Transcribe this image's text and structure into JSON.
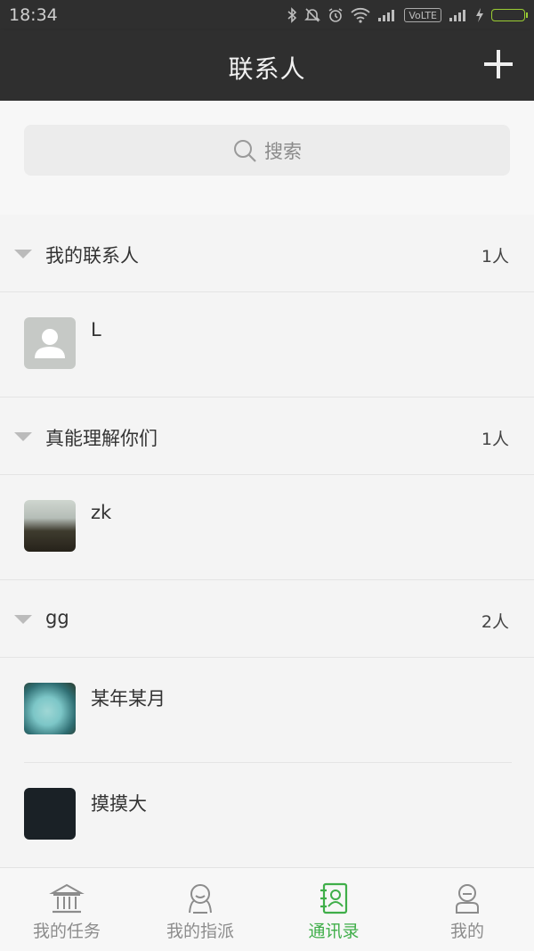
{
  "status_bar": {
    "time": "18:34",
    "network_label": "VoLTE",
    "icons": [
      "bluetooth-icon",
      "mute-icon",
      "alarm-icon",
      "wifi-icon",
      "signal-icon",
      "signal-icon",
      "charging-icon",
      "battery-icon"
    ]
  },
  "header": {
    "title": "联系人",
    "add_icon": "plus-icon"
  },
  "search": {
    "placeholder": "搜索",
    "icon": "search-icon"
  },
  "groups": [
    {
      "name": "我的联系人",
      "count": "1人",
      "contacts": [
        {
          "name": "L",
          "avatar": "default-avatar"
        }
      ]
    },
    {
      "name": "真能理解你们",
      "count": "1人",
      "contacts": [
        {
          "name": "zk",
          "avatar": "photo"
        }
      ]
    },
    {
      "name": "gg",
      "count": "2人",
      "contacts": [
        {
          "name": "某年某月",
          "avatar": "photo"
        },
        {
          "name": "摸摸大",
          "avatar": "photo"
        }
      ]
    }
  ],
  "tabs": [
    {
      "label": "我的任务",
      "icon": "bank-icon",
      "active": false
    },
    {
      "label": "我的指派",
      "icon": "assign-icon",
      "active": false
    },
    {
      "label": "通讯录",
      "icon": "contacts-book-icon",
      "active": true
    },
    {
      "label": "我的",
      "icon": "user-icon",
      "active": false
    }
  ],
  "colors": {
    "header_bg": "#2f2f2f",
    "active_tab": "#3fae49",
    "inactive_tab": "#8c8c8c",
    "background": "#f4f4f4"
  }
}
